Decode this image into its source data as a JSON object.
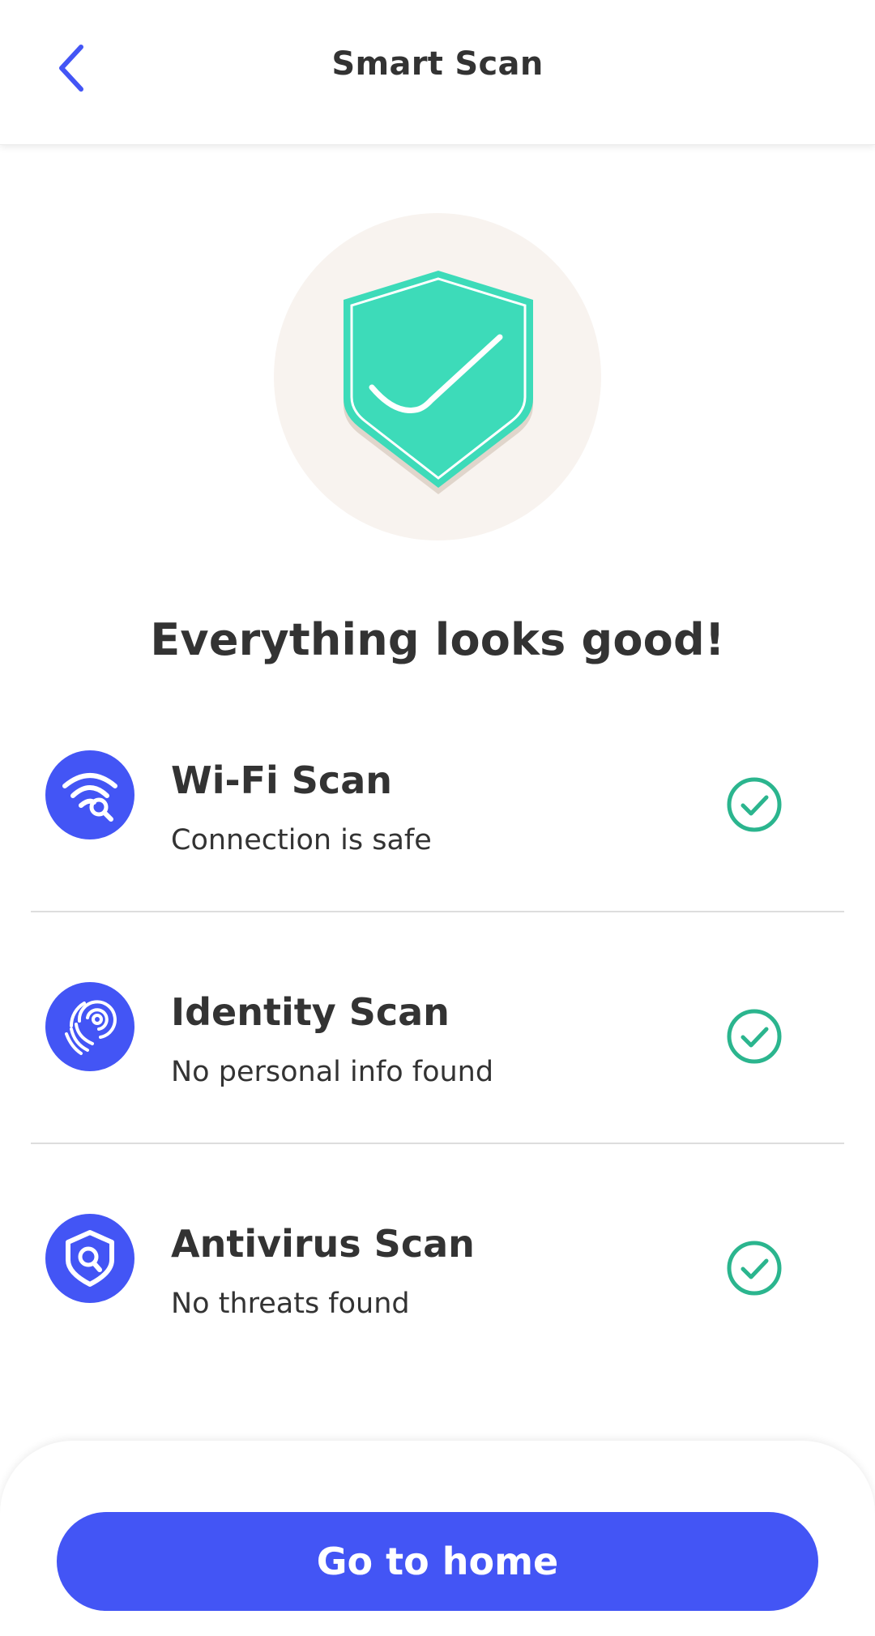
{
  "header": {
    "title": "Smart Scan",
    "back_icon": "chevron-left-icon"
  },
  "hero": {
    "icon": "shield-check-icon",
    "headline": "Everything looks good!"
  },
  "scans": [
    {
      "title": "Wi-Fi Scan",
      "subtitle": "Connection is safe",
      "icon": "wifi-search-icon",
      "status_icon": "check-circle-icon"
    },
    {
      "title": "Identity Scan",
      "subtitle": "No personal info found",
      "icon": "fingerprint-icon",
      "status_icon": "check-circle-icon"
    },
    {
      "title": "Antivirus Scan",
      "subtitle": "No threats found",
      "icon": "shield-search-icon",
      "status_icon": "check-circle-icon"
    }
  ],
  "footer": {
    "button_label": "Go to home"
  },
  "colors": {
    "accent": "#4355f5",
    "success": "#2bb58e",
    "shield": "#3ddbb9",
    "hero_bg": "#f8f3ef",
    "text": "#333333"
  }
}
